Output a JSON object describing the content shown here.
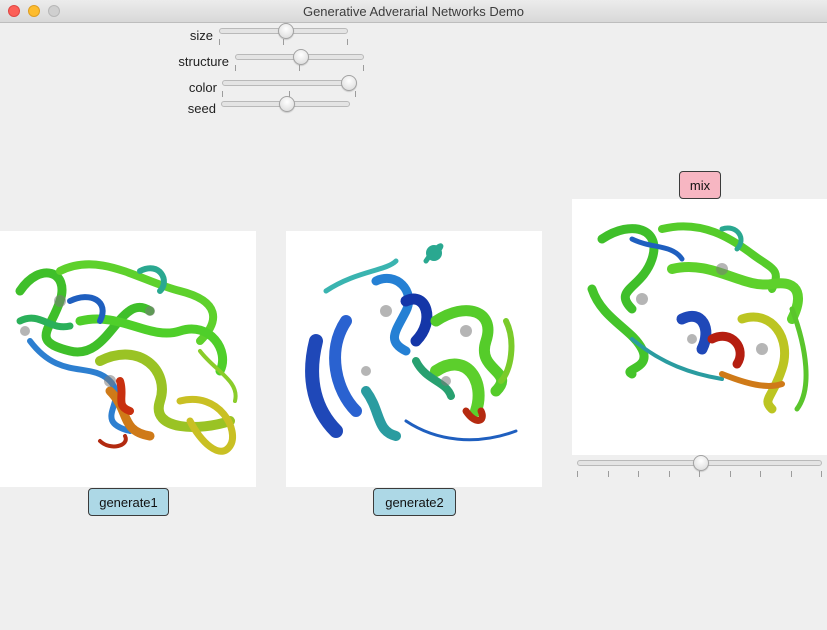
{
  "window": {
    "title": "Generative Adverarial Networks Demo"
  },
  "controls": {
    "size": {
      "label": "size",
      "value": 0.51
    },
    "structure": {
      "label": "structure",
      "value": 0.5
    },
    "color": {
      "label": "color",
      "value": 0.99
    },
    "seed": {
      "label": "seed",
      "value": 0.5
    }
  },
  "buttons": {
    "generate1": "generate1",
    "generate2": "generate2",
    "mix": "mix"
  },
  "mix_slider": {
    "value": 0.5
  },
  "colors": {
    "button_blue": "#add8e6",
    "button_pink": "#f7b6c2"
  }
}
